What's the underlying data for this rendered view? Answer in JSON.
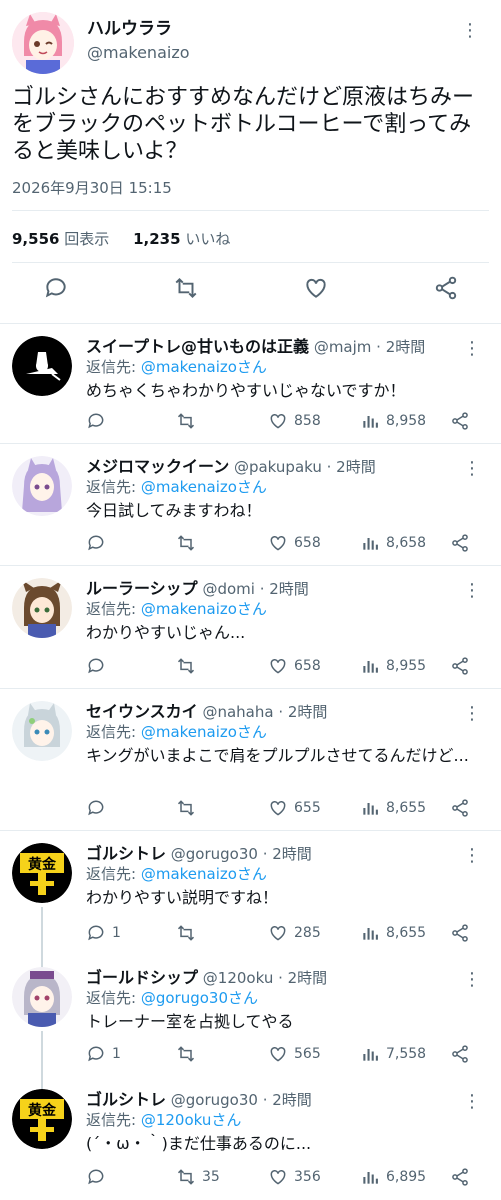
{
  "main": {
    "name": "ハルウララ",
    "handle": "@makenaizo",
    "text": "ゴルシさんにおすすめなんだけど原液はちみーをブラックのペットボトルコーヒーで割ってみると美味しいよ？",
    "timestamp": "2026年9月30日 15:15",
    "views": "9,556",
    "views_label": "回表示",
    "likes": "1,235",
    "likes_label": "いいね",
    "more": "⋮"
  },
  "replies": [
    {
      "name": "スイープトレ@甘いものは正義",
      "meta": " @majm · 2時間",
      "replyto_prefix": "返信先: ",
      "replyto": "@makenaizoさん",
      "text": "めちゃくちゃわかりやすいじゃないですか！",
      "replies": "",
      "retweets": "",
      "likes": "858",
      "views": "8,958"
    },
    {
      "name": "メジロマックイーン",
      "meta": " @pakupaku · 2時間",
      "replyto_prefix": "返信先: ",
      "replyto": "@makenaizoさん",
      "text": "今日試してみますわね！",
      "replies": "",
      "retweets": "",
      "likes": "658",
      "views": "8,658"
    },
    {
      "name": "ルーラーシップ",
      "meta": " @domi · 2時間",
      "replyto_prefix": "返信先: ",
      "replyto": "@makenaizoさん",
      "text": "わかりやすいじゃん...",
      "replies": "",
      "retweets": "",
      "likes": "658",
      "views": "8,955"
    },
    {
      "name": "セイウンスカイ",
      "meta": " @nahaha · 2時間",
      "replyto_prefix": "返信先: ",
      "replyto": "@makenaizoさん",
      "text": "キングがいまよこで肩をプルプルさせてるんだけど...",
      "replies": "",
      "retweets": "",
      "likes": "655",
      "views": "8,655"
    },
    {
      "name": "ゴルシトレ",
      "meta": " @gorugo30 · 2時間",
      "replyto_prefix": "返信先: ",
      "replyto": "@makenaizoさん",
      "text": "わかりやすい説明ですね！",
      "replies": "1",
      "retweets": "",
      "likes": "285",
      "views": "8,655"
    },
    {
      "name": "ゴールドシップ",
      "meta": " @120oku · 2時間",
      "replyto_prefix": "返信先: ",
      "replyto": "@gorugo30さん",
      "text": "トレーナー室を占拠してやる",
      "replies": "1",
      "retweets": "",
      "likes": "565",
      "views": "7,558"
    },
    {
      "name": "ゴルシトレ",
      "meta": " @gorugo30 · 2時間",
      "replyto_prefix": "返信先: ",
      "replyto": "@120okuさん",
      "text": "(´・ω・｀)まだ仕事あるのに...",
      "replies": "",
      "retweets": "35",
      "likes": "356",
      "views": "6,895"
    }
  ],
  "avatar_badge": "黄金",
  "colors": {
    "link": "#1d9bf0",
    "secondary": "#536471",
    "divider": "#e6ecf0"
  }
}
